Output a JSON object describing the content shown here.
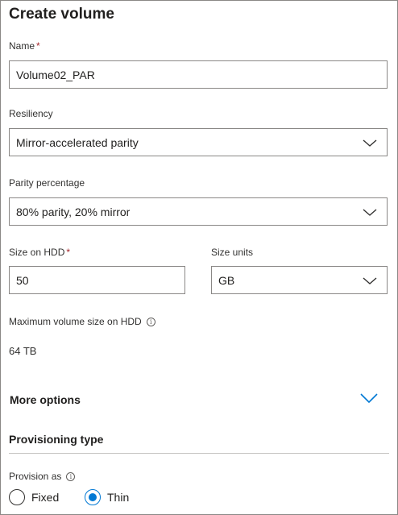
{
  "panel": {
    "title": "Create volume"
  },
  "name_field": {
    "label": "Name",
    "required_marker": "*",
    "value": "Volume02_PAR"
  },
  "resiliency": {
    "label": "Resiliency",
    "selected": "Mirror-accelerated parity"
  },
  "parity_percentage": {
    "label": "Parity percentage",
    "selected": "80% parity, 20% mirror"
  },
  "size_on_hdd": {
    "label": "Size on HDD",
    "required_marker": "*",
    "value": "50"
  },
  "size_units": {
    "label": "Size units",
    "selected": "GB"
  },
  "max_volume_size": {
    "label": "Maximum volume size on HDD",
    "info_icon": "info-icon",
    "value": "64 TB"
  },
  "more_options": {
    "label": "More options",
    "icon": "chevron-down-icon"
  },
  "provisioning": {
    "heading": "Provisioning type",
    "provision_as_label": "Provision as",
    "info_icon": "info-icon",
    "options": [
      {
        "label": "Fixed",
        "checked": false
      },
      {
        "label": "Thin",
        "checked": true
      }
    ]
  },
  "colors": {
    "accent": "#0078d4",
    "required": "#a4262c",
    "border": "#8a8886"
  }
}
